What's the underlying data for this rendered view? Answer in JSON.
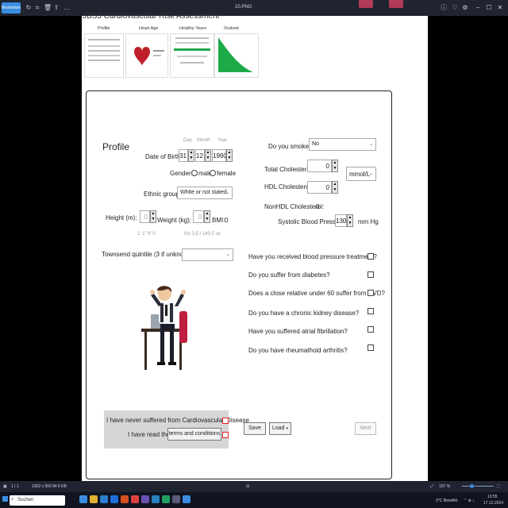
{
  "window": {
    "app_button_label": "Bearbeiten",
    "title": "10.PNG",
    "heading": "JBS3 Cardiovascular Risk Assessment"
  },
  "tabs": [
    {
      "label": "Profile"
    },
    {
      "label": "Heart Age"
    },
    {
      "label": "Healthy Years"
    },
    {
      "label": "Outlook"
    }
  ],
  "profile": {
    "title": "Profile",
    "dob": {
      "label": "Date of Birth",
      "day_header": "Day",
      "month_header": "Month",
      "year_header": "Year",
      "day": "31",
      "month": "12",
      "year": "1990"
    },
    "gender": {
      "label": "Gender:",
      "male": "male",
      "female": "female"
    },
    "ethnic": {
      "label": "Ethnic group",
      "value": "White or not stated"
    },
    "height": {
      "label": "Height (m):",
      "value": "0",
      "hint": "1' 1\"  ft' 0"
    },
    "weight": {
      "label": "Weight (kg):",
      "value": "0",
      "hint": "0st 3.5 / 143.5 oz"
    },
    "bmi": {
      "label": "BMI:",
      "value": "0"
    },
    "townsend": {
      "label": "Townsend quintile (3 if unknown):",
      "value": ""
    }
  },
  "risk": {
    "smoke": {
      "label": "Do you smoke?",
      "value": "No"
    },
    "total_chol": {
      "label": "Total Cholesterol:",
      "value": "0"
    },
    "units": {
      "value": "mmol/L"
    },
    "hdl": {
      "label": "HDL Cholesterol:",
      "value": "0"
    },
    "nonhdl": {
      "label": "NonHDL Cholesterol:",
      "value": "0"
    },
    "sbp": {
      "label": "Systolic Blood Pressure:",
      "value": "130",
      "unit": "mm Hg"
    }
  },
  "questions": [
    "Have you received blood pressure treatment?",
    "Do you suffer from diabetes?",
    "Does a close relative under 60 suffer from CVD?",
    "Do you have a chronic kidney disease?",
    "Have you suffered atrial fibrillation?",
    "Do you have rheumathoid arthritis?"
  ],
  "footer": {
    "never_cvd": "I have never suffered from Cardiovascular Disease",
    "read_the": "I have read the",
    "terms_button": "terms and conditions",
    "save": "Save",
    "load": "Load",
    "next": "Next"
  },
  "statusbar": {
    "left": "1 / 1",
    "dims": "1302 x 900",
    "size": "94.6 KB",
    "zoom": "107 %"
  },
  "taskbar": {
    "search_placeholder": "Suchen",
    "weather": "3°C Bewölkt",
    "time": "13:55",
    "date": "17.12.2024"
  },
  "colors": {
    "accent": "#3a8de0",
    "outlook_green": "#1faa4a",
    "heart_red": "#c0202a",
    "required_red": "#dd2222"
  }
}
